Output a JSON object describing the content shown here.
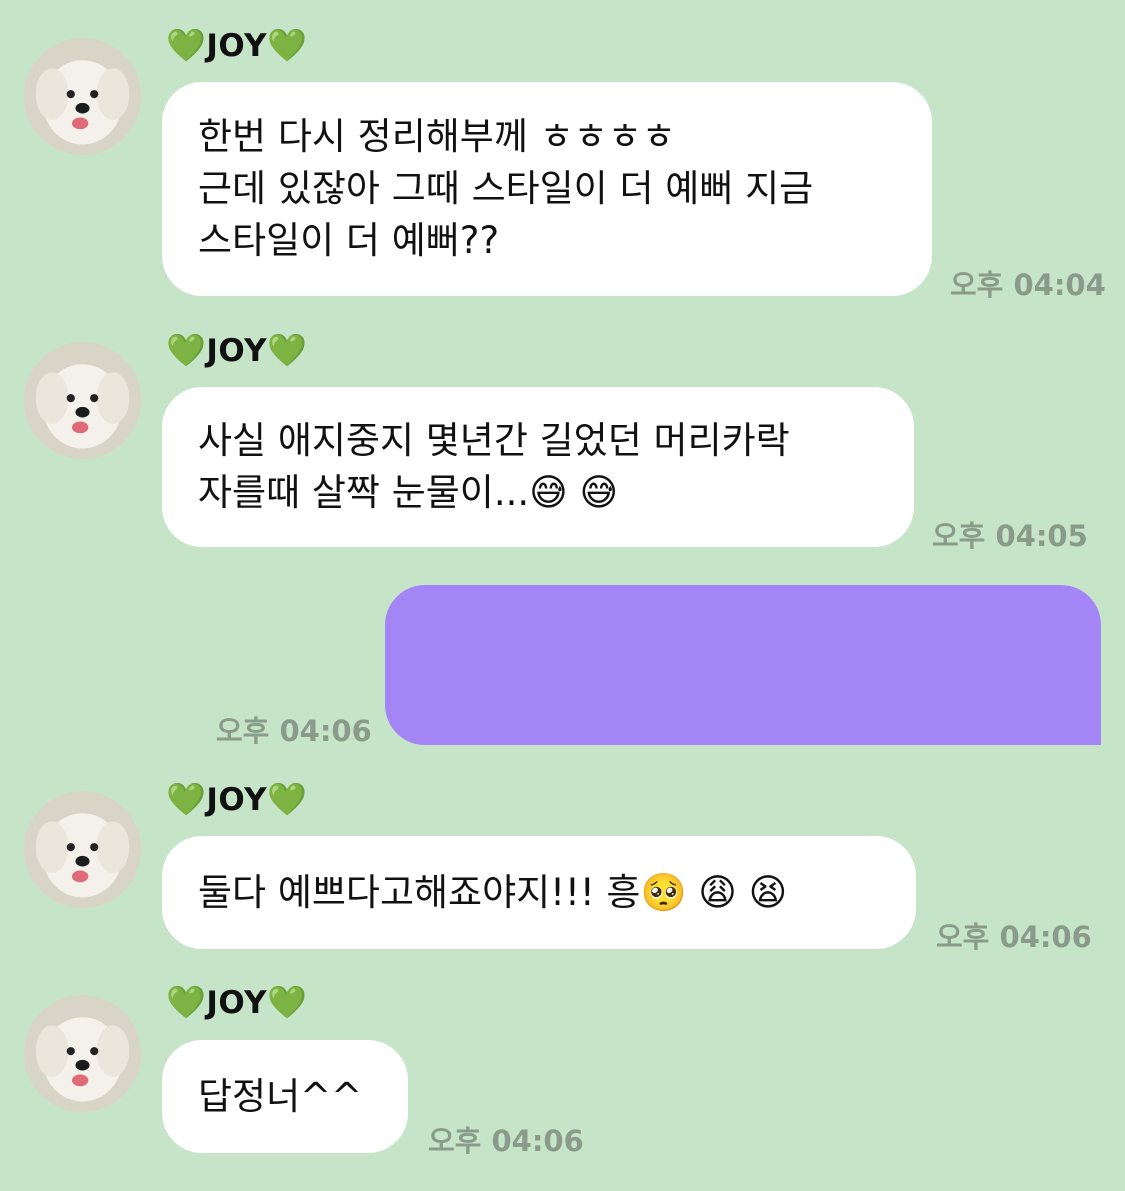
{
  "sender_name": "JOY",
  "heart_icon": "green-heart",
  "colors": {
    "background": "#c6e5c8",
    "incoming_bubble": "#ffffff",
    "outgoing_bubble": "#a385f5",
    "heart": "#2fc42f",
    "timestamp": "#8a9a8b"
  },
  "messages": [
    {
      "direction": "incoming",
      "lines": [
        "한번 다시 정리해부께 ㅎㅎㅎㅎ",
        "근데 있잖아 그때 스타일이 더 예뻐 지금",
        "스타일이 더 예뻐??"
      ],
      "time": "오후 04:04"
    },
    {
      "direction": "incoming",
      "lines": [
        "사실 애지중지 몇년간 길었던 머리카락",
        "자를때 살짝 눈물이...😅 😅"
      ],
      "time": "오후 04:05"
    },
    {
      "direction": "outgoing",
      "lines": [],
      "time": "오후 04:06"
    },
    {
      "direction": "incoming",
      "lines": [
        "둘다 예쁘다고해죠야지!!! 흥🥺 😩 😫"
      ],
      "time": "오후 04:06"
    },
    {
      "direction": "incoming",
      "lines": [
        "답정너^^"
      ],
      "time": "오후 04:06"
    }
  ]
}
